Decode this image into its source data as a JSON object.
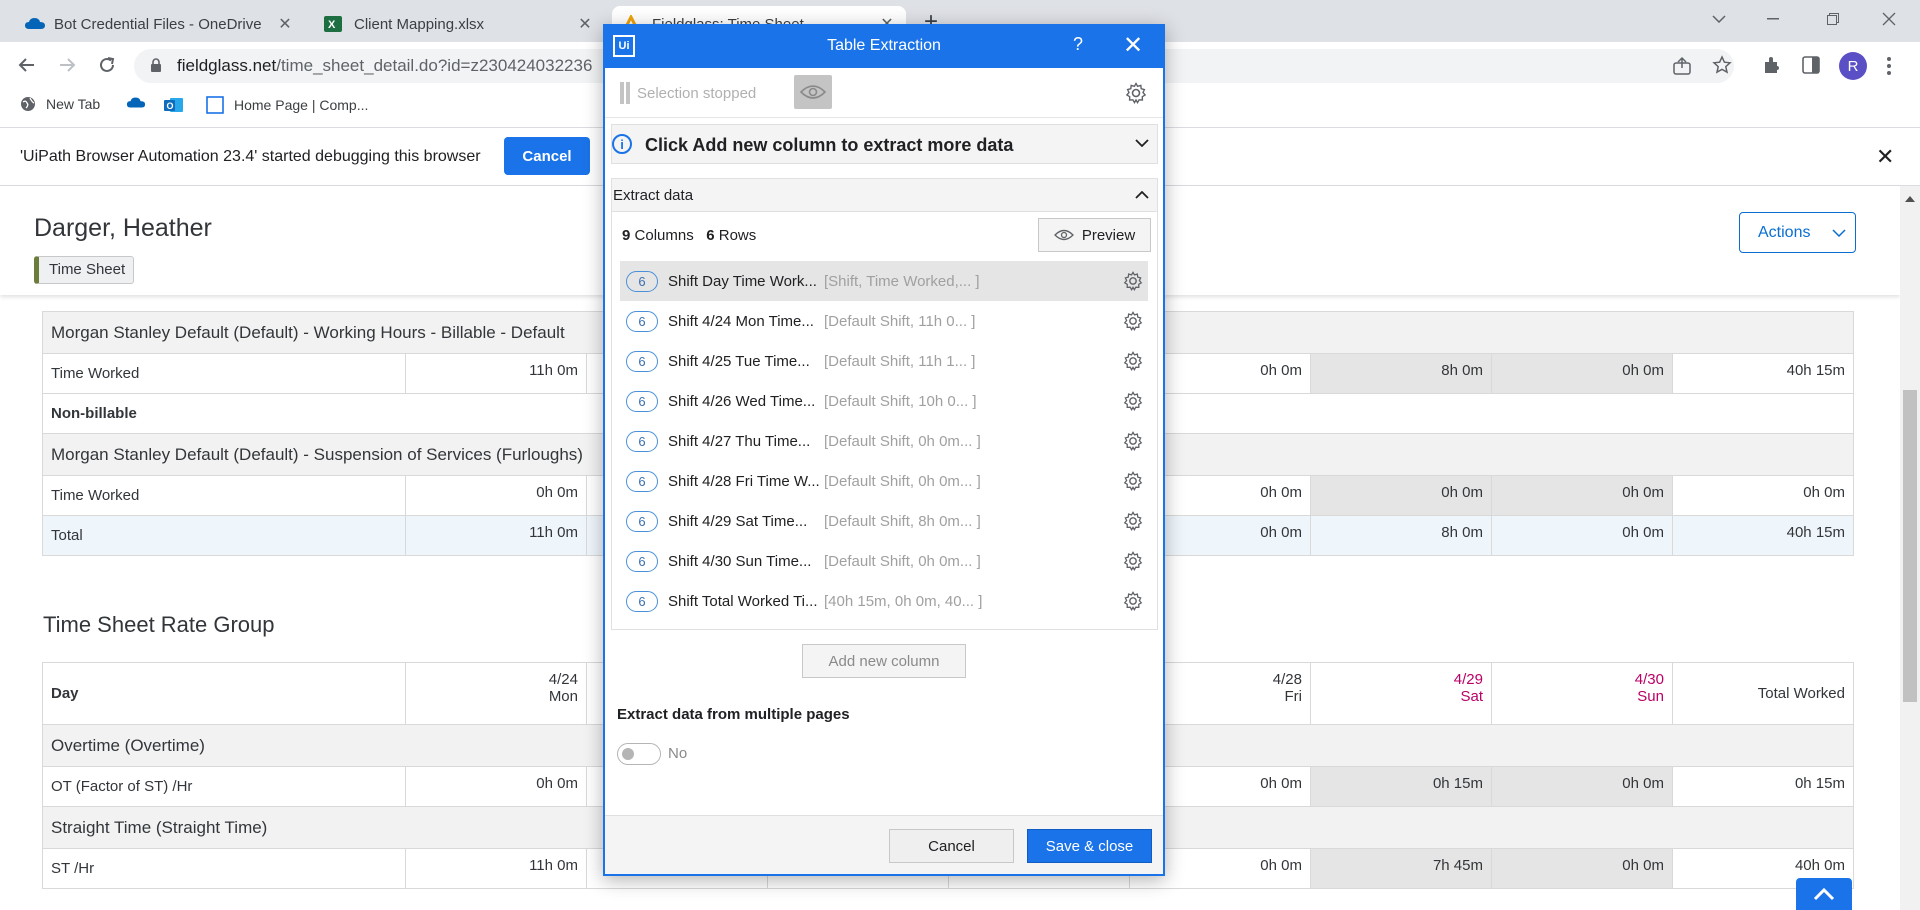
{
  "browser": {
    "tabs": [
      {
        "title": "Bot Credential Files - OneDrive",
        "close": "✕"
      },
      {
        "title": "Client Mapping.xlsx",
        "close": "✕"
      },
      {
        "title": "Fieldglass: Time Sheet",
        "close": "✕"
      }
    ],
    "new_tab": "+",
    "url_host": "fieldglass.net",
    "url_path": "/time_sheet_detail.do?id=z230424032236",
    "profile_initial": "R",
    "bookmarks": [
      {
        "label": "New Tab"
      },
      {
        "label": ""
      },
      {
        "label": ""
      },
      {
        "label": "Home Page | Comp..."
      }
    ]
  },
  "debug_bar": {
    "message": "'UiPath Browser Automation 23.4' started debugging this browser",
    "cancel_label": "Cancel",
    "close": "✕"
  },
  "page": {
    "person_name": "Darger, Heather",
    "badge": "Time Sheet",
    "actions_label": "Actions",
    "billable_section": "Morgan Stanley Default (Default) - Working Hours - Billable - Default",
    "time_worked_label": "Time Worked",
    "billable_values": {
      "mon": "11h 0m",
      "fri": "0h 0m",
      "sat": "8h 0m",
      "sun": "0h 0m",
      "total": "40h 15m"
    },
    "nonbillable_label": "Non-billable",
    "furlough_section": "Morgan Stanley Default (Default) - Suspension of Services (Furloughs)",
    "furlough_values": {
      "mon": "0h 0m",
      "fri": "0h 0m",
      "sat": "0h 0m",
      "sun": "0h 0m",
      "total": "0h 0m"
    },
    "total_label": "Total",
    "total_values": {
      "mon": "11h 0m",
      "fri": "0h 0m",
      "sat": "8h 0m",
      "sun": "0h 0m",
      "total": "40h 15m"
    },
    "rate_group_title": "Time Sheet Rate Group",
    "day_label": "Day",
    "day_headers": {
      "mon_date": "4/24",
      "mon_day": "Mon",
      "fri_date": "4/28",
      "fri_day": "Fri",
      "sat_date": "4/29",
      "sat_day": "Sat",
      "sun_date": "4/30",
      "sun_day": "Sun",
      "total": "Total Worked"
    },
    "overtime_section": "Overtime (Overtime)",
    "ot_label": "OT (Factor of ST) /Hr",
    "ot_values": {
      "mon": "0h 0m",
      "fri": "0h 0m",
      "sat": "0h 15m",
      "sun": "0h 0m",
      "total": "0h 15m"
    },
    "straight_section": "Straight Time (Straight Time)",
    "st_label": "ST /Hr",
    "st_values": {
      "mon": "11h 0m",
      "fri": "0h 0m",
      "sat": "7h 45m",
      "sun": "0h 0m",
      "total": "40h 0m"
    },
    "weekend_color": "#bb0066"
  },
  "dialog": {
    "logo": "Ui",
    "title": "Table Extraction",
    "help": "?",
    "close": "✕",
    "selection_status": "Selection stopped",
    "info_message": "Click Add new column to extract more data",
    "extract_header": "Extract data",
    "columns_count": "9",
    "columns_label": "Columns",
    "rows_count": "6",
    "rows_label": "Rows",
    "preview_label": "Preview",
    "columns": [
      {
        "count": "6",
        "name": "Shift Day Time Work...",
        "preview": "[Shift, Time Worked,... ]"
      },
      {
        "count": "6",
        "name": "Shift 4/24 Mon Time...",
        "preview": "[Default Shift, 11h 0... ]"
      },
      {
        "count": "6",
        "name": "Shift 4/25 Tue Time...",
        "preview": "[Default Shift, 11h 1... ]"
      },
      {
        "count": "6",
        "name": "Shift 4/26 Wed Time...",
        "preview": "[Default Shift, 10h 0... ]"
      },
      {
        "count": "6",
        "name": "Shift 4/27 Thu Time...",
        "preview": "[Default Shift, 0h 0m... ]"
      },
      {
        "count": "6",
        "name": "Shift 4/28 Fri Time W...",
        "preview": "[Default Shift, 0h 0m... ]"
      },
      {
        "count": "6",
        "name": "Shift 4/29 Sat Time...",
        "preview": "[Default Shift, 8h 0m... ]"
      },
      {
        "count": "6",
        "name": "Shift 4/30 Sun Time...",
        "preview": "[Default Shift, 0h 0m... ]"
      },
      {
        "count": "6",
        "name": "Shift Total Worked Ti...",
        "preview": "[40h 15m, 0h 0m, 40... ]"
      }
    ],
    "add_column_label": "Add new column",
    "multi_page_label": "Extract data from multiple pages",
    "toggle_value": "No",
    "cancel_label": "Cancel",
    "save_label": "Save & close",
    "accent": "#1a73e8"
  }
}
